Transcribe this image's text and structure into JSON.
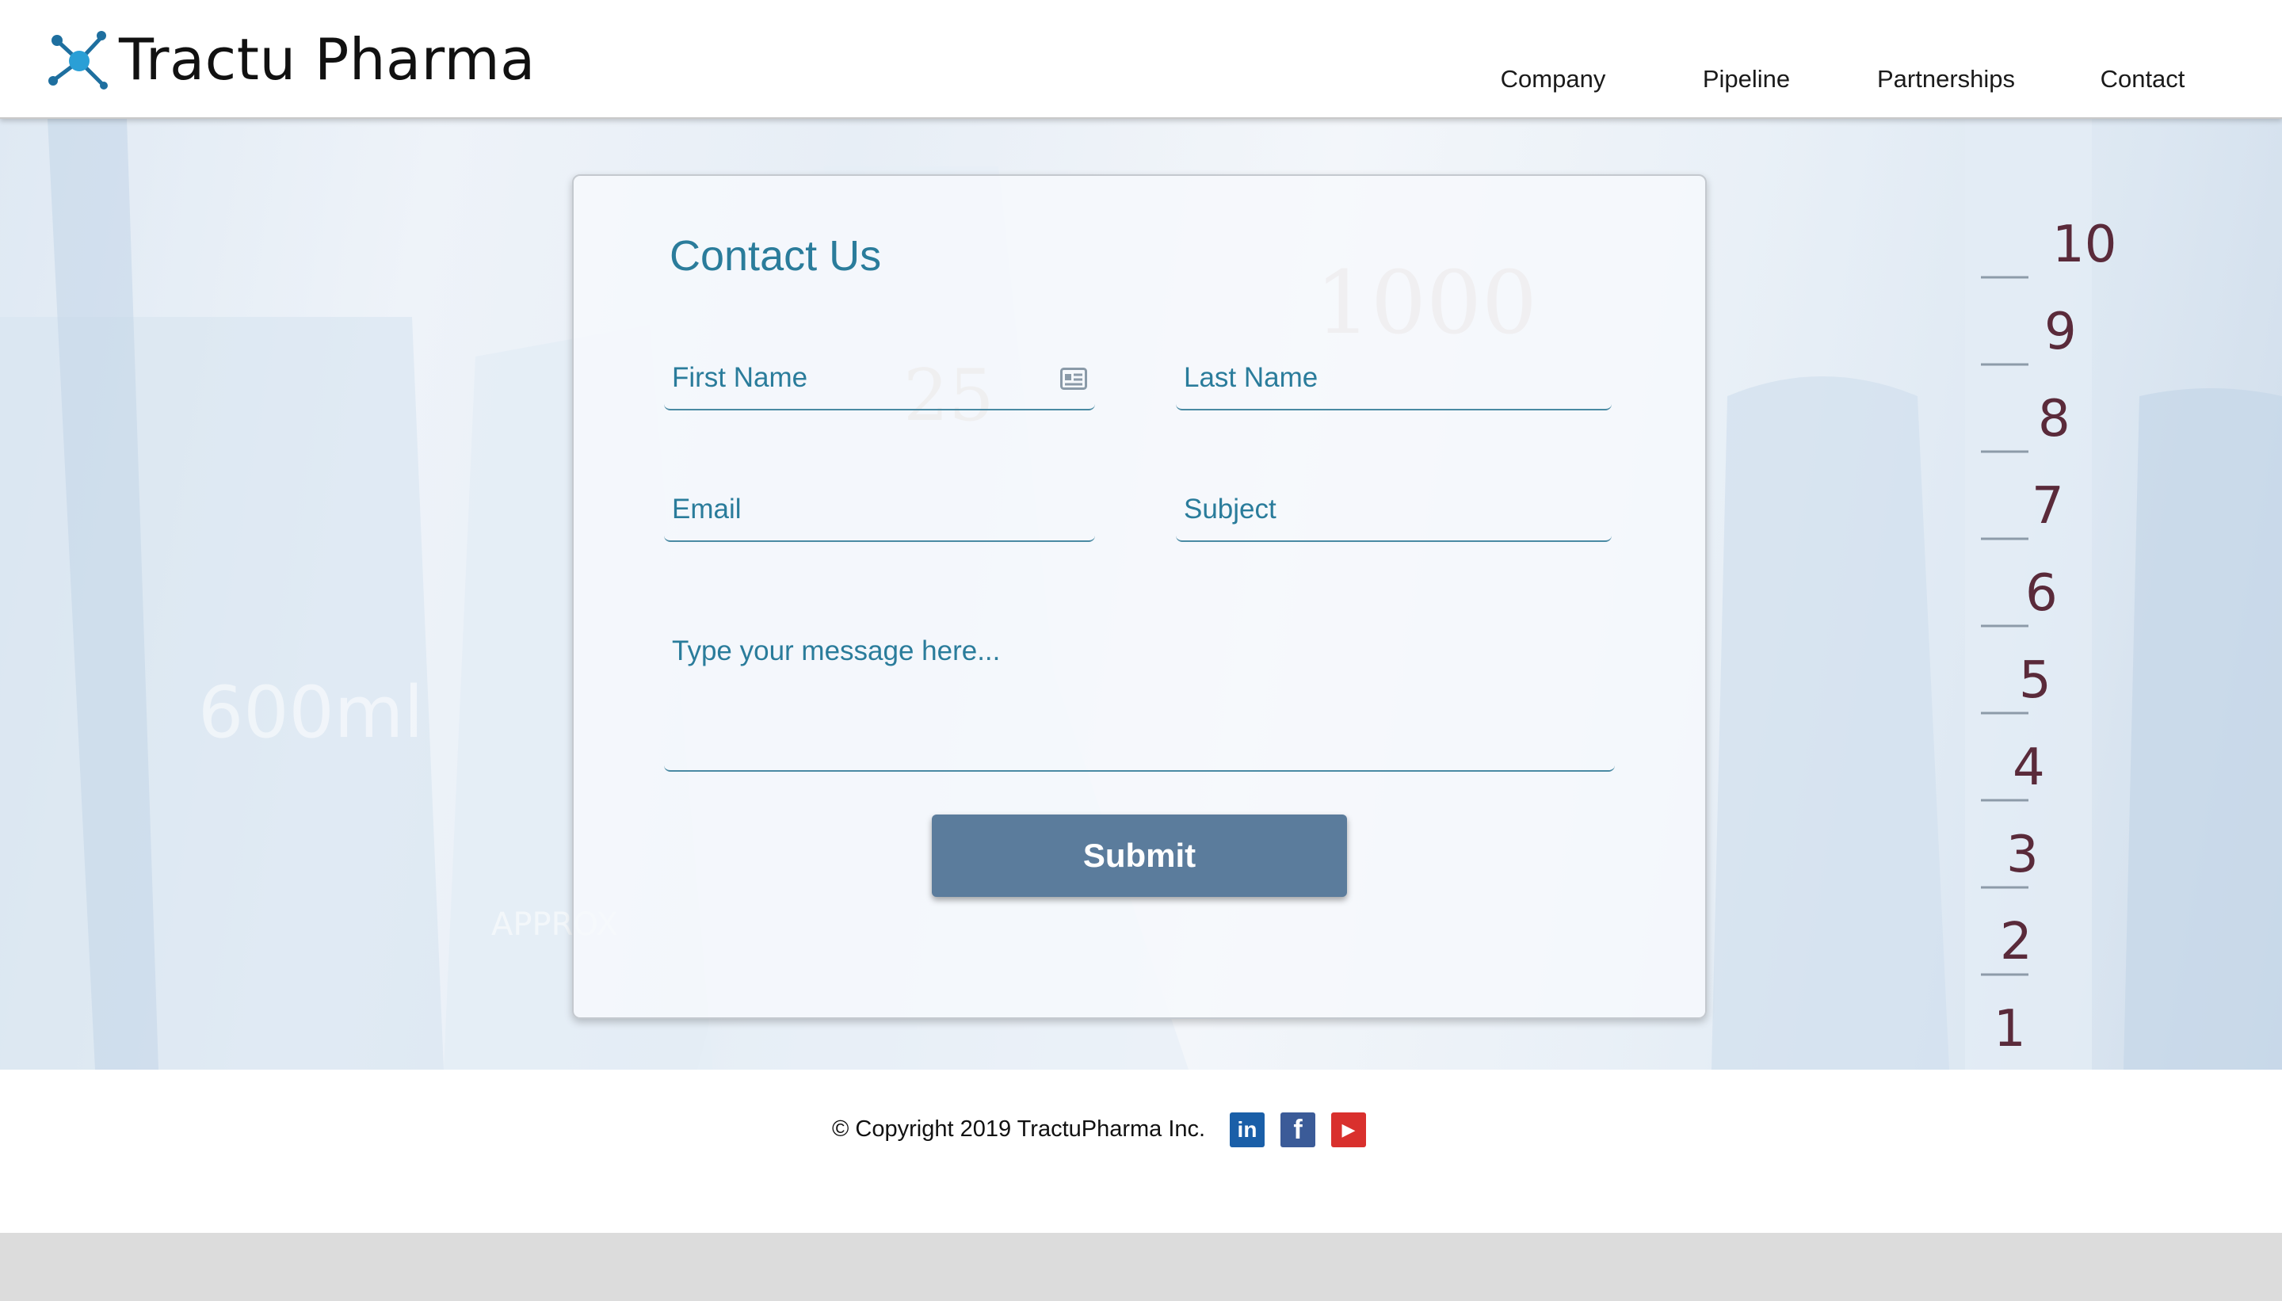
{
  "header": {
    "brand": "Tractu Pharma",
    "logo_icon": "molecule-icon",
    "nav": [
      {
        "label": "Company"
      },
      {
        "label": "Pipeline"
      },
      {
        "label": "Partnerships"
      },
      {
        "label": "Contact"
      }
    ]
  },
  "hero": {
    "background": "laboratory-glassware-photo"
  },
  "contact_form": {
    "title": "Contact Us",
    "first_name": {
      "placeholder": "First Name",
      "value": ""
    },
    "last_name": {
      "placeholder": "Last Name",
      "value": ""
    },
    "email": {
      "placeholder": "Email",
      "value": ""
    },
    "subject": {
      "placeholder": "Subject",
      "value": ""
    },
    "message": {
      "placeholder": "Type your message here...",
      "value": ""
    },
    "autofill_icon": "contact-card-icon",
    "submit_label": "Submit"
  },
  "footer": {
    "copyright": "© Copyright 2019 TractuPharma Inc.",
    "social": [
      {
        "name": "linkedin-icon",
        "glyph": "in",
        "color": "#1a5fa8"
      },
      {
        "name": "facebook-icon",
        "glyph": "f",
        "color": "#3b5b98"
      },
      {
        "name": "youtube-icon",
        "glyph": "▶",
        "color": "#d9302d"
      }
    ]
  },
  "colors": {
    "accent": "#2a7c9b",
    "submit_bg": "#5b7c9c",
    "footer_bar": "#dcdcdc"
  }
}
